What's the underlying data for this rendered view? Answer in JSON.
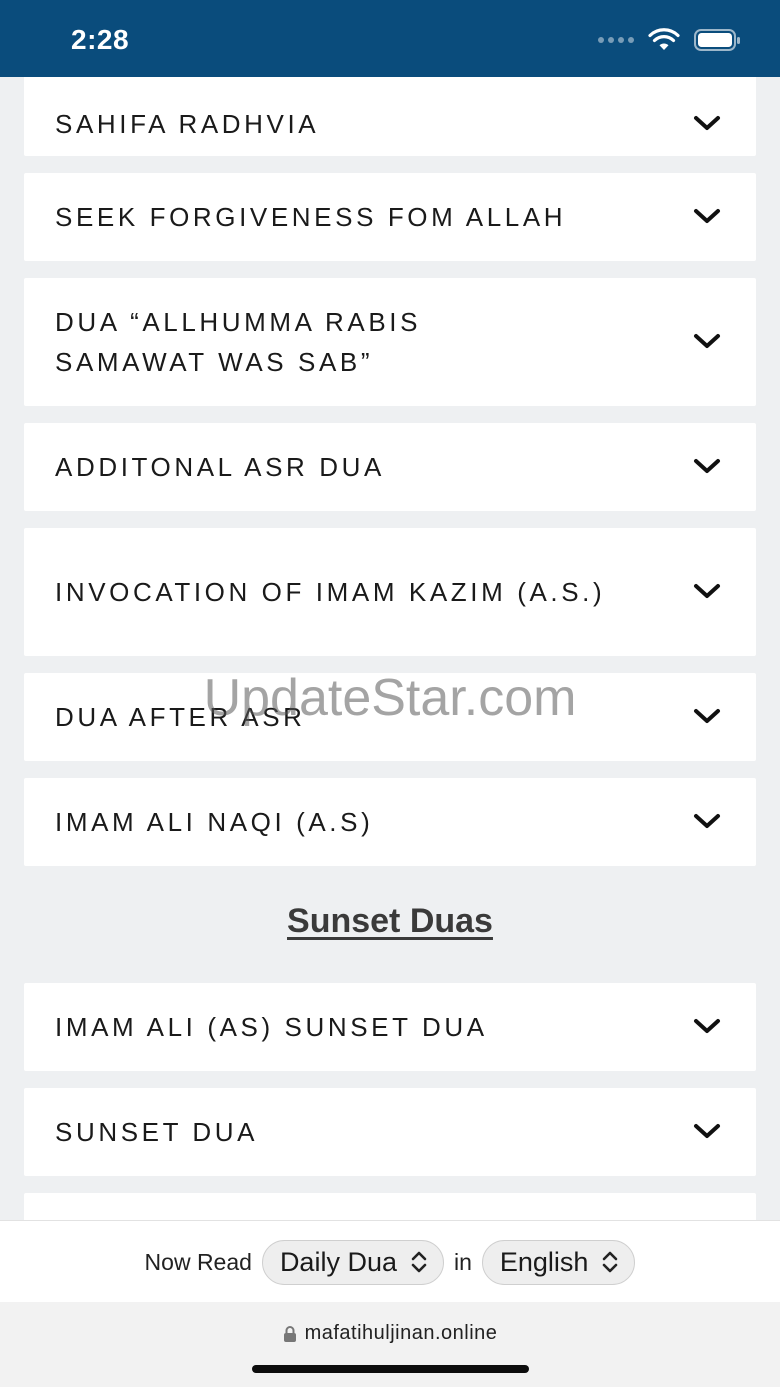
{
  "status_bar": {
    "time": "2:28"
  },
  "items_before": [
    {
      "label": "SAHIFA RADHVIA"
    },
    {
      "label": "SEEK FORGIVENESS FOM ALLAH"
    },
    {
      "label": "DUA “ALLHUMMA RABIS SAMAWAT WAS SAB”"
    },
    {
      "label": "ADDITONAL ASR DUA"
    },
    {
      "label": "INVOCATION OF IMAM KAZIM (A.S.)"
    },
    {
      "label": "DUA AFTER ASR"
    },
    {
      "label": "IMAM ALI NAQI (A.S)"
    }
  ],
  "section": {
    "title": "Sunset Duas"
  },
  "items_after": [
    {
      "label": "IMAM ALI (AS) SUNSET DUA"
    },
    {
      "label": "SUNSET DUA"
    }
  ],
  "watermark": "UpdateStar.com",
  "read_bar": {
    "prefix": "Now Read",
    "book_select": "Daily Dua",
    "connector": "in",
    "language_select": "English"
  },
  "browser": {
    "url": "mafatihuljinan.online"
  },
  "icons": {
    "chevron": "chevron-down-icon",
    "select": "up-down-chevron-icon",
    "lock": "lock-icon",
    "wifi": "wifi-icon",
    "battery": "battery-icon"
  },
  "colors": {
    "status_bar": "#0a4c7c",
    "background": "#eef0f2",
    "card": "#ffffff"
  }
}
